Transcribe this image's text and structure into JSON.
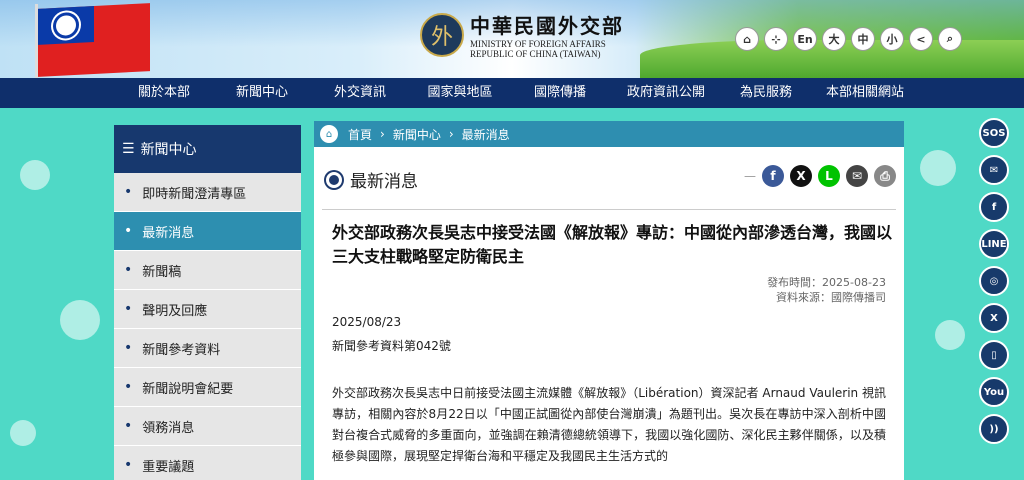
{
  "header": {
    "logo_zh": "中華民國外交部",
    "logo_en1": "MINISTRY OF FOREIGN AFFAIRS",
    "logo_en2": "REPUBLIC OF CHINA (TAIWAN)",
    "buttons": [
      {
        "name": "home-icon",
        "label": "⌂"
      },
      {
        "name": "sitemap-icon",
        "label": "⊹"
      },
      {
        "name": "english-button",
        "label": "En"
      },
      {
        "name": "font-large-button",
        "label": "大"
      },
      {
        "name": "font-medium-button",
        "label": "中"
      },
      {
        "name": "font-small-button",
        "label": "小"
      },
      {
        "name": "share-icon",
        "label": "<"
      },
      {
        "name": "search-icon",
        "label": "⌕"
      }
    ]
  },
  "nav": [
    "關於本部",
    "新聞中心",
    "外交資訊",
    "國家與地區",
    "國際傳播",
    "政府資訊公開",
    "為民服務",
    "本部相關網站"
  ],
  "sidebar": {
    "title": "新聞中心",
    "items": [
      "即時新聞澄清專區",
      "最新消息",
      "新聞稿",
      "聲明及回應",
      "新聞參考資料",
      "新聞說明會紀要",
      "領務消息",
      "重要議題"
    ]
  },
  "breadcrumb": [
    "首頁",
    "新聞中心",
    "最新消息"
  ],
  "section_title": "最新消息",
  "article": {
    "headline": "外交部政務次長吳志中接受法國《解放報》專訪：中國從內部滲透台灣，我國以三大支柱戰略堅定防衛民主",
    "publish_time": "發布時間：2025-08-23",
    "source": "資料來源：國際傳播司",
    "date": "2025/08/23",
    "ref_no": "新聞參考資料第042號",
    "body": "外交部政務次長吳志中日前接受法國主流媒體《解放報》（Libération）資深記者 Arnaud Vaulerin 視訊專訪，相關內容於8月22日以「中國正試圖從內部使台灣崩潰」為題刊出。吳次長在專訪中深入剖析中國對台複合式威脅的多重面向，並強調在賴清德總統領導下，我國以強化國防、深化民主夥伴關係，以及積極參與國際，展現堅定捍衛台海和平穩定及我國民主生活方式的"
  },
  "share_icons": [
    {
      "name": "facebook-share-icon",
      "label": "f",
      "color": "#3b5998"
    },
    {
      "name": "x-share-icon",
      "label": "X",
      "color": "#111111"
    },
    {
      "name": "line-share-icon",
      "label": "L",
      "color": "#00c300"
    },
    {
      "name": "email-share-icon",
      "label": "✉",
      "color": "#444444"
    },
    {
      "name": "print-icon",
      "label": "⎙",
      "color": "#888888"
    }
  ],
  "right_social": [
    "SOS",
    "✉",
    "f",
    "LINE",
    "◎",
    "X",
    "▯",
    "You",
    "))"
  ]
}
